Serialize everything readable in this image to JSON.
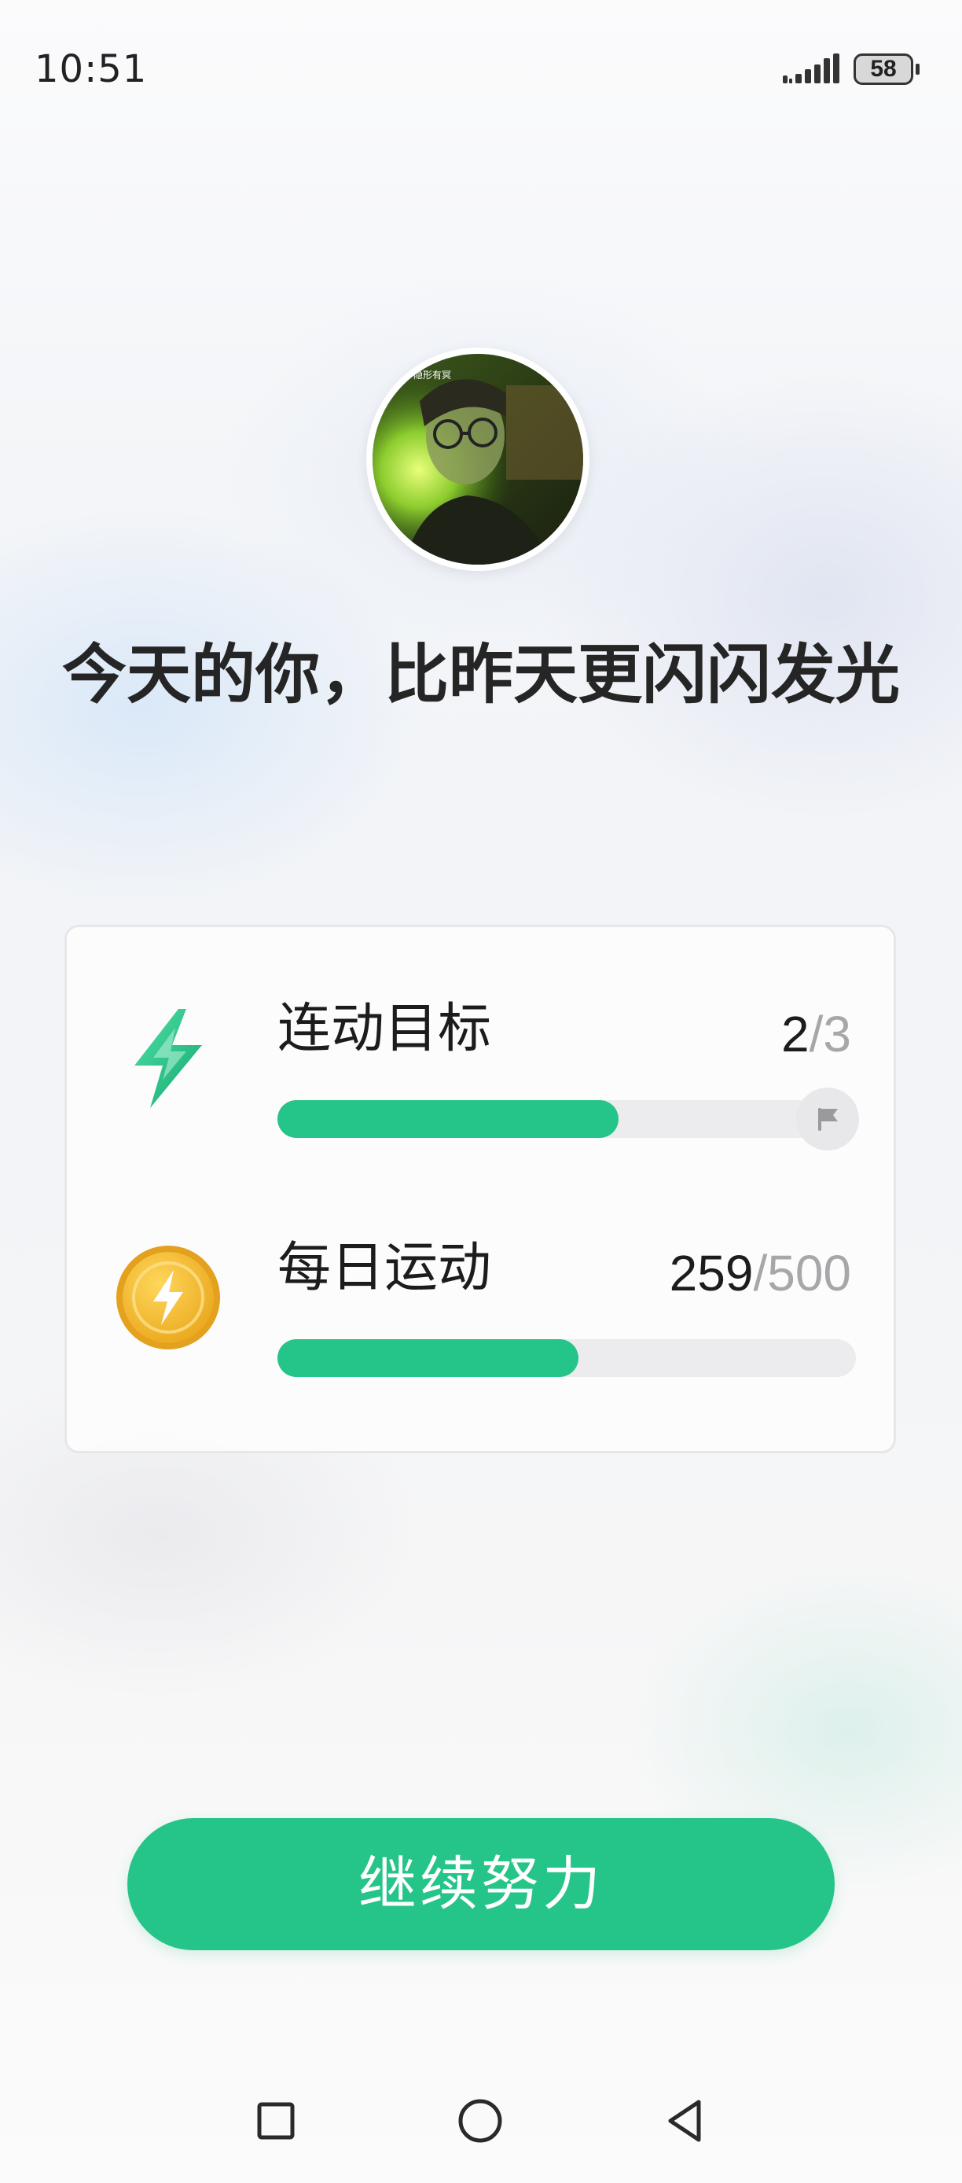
{
  "status_bar": {
    "time": "10:51",
    "battery": "58",
    "icons": [
      "signal-icon",
      "battery-icon"
    ]
  },
  "avatar": {
    "caption": "隐形有冥",
    "icon": "user-avatar"
  },
  "headline": "今天的你，比昨天更闪闪发光",
  "goals": [
    {
      "label": "连动目标",
      "current": "2",
      "separator": "/",
      "target": "3",
      "progress": 0.59,
      "icon": "lightning-icon",
      "end_icon": "flag-icon"
    },
    {
      "label": "每日运动",
      "current": "259",
      "separator": "/",
      "target": "500",
      "progress": 0.52,
      "icon": "coin-lightning-icon"
    }
  ],
  "continue_button": "继续努力",
  "nav": {
    "icons": [
      "recent-apps-icon",
      "home-icon",
      "back-icon"
    ]
  },
  "colors": {
    "accent": "#25c488",
    "track": "#ececee",
    "text": "#252525",
    "muted": "#a7a7aa",
    "coin": "#f2bb2c"
  }
}
